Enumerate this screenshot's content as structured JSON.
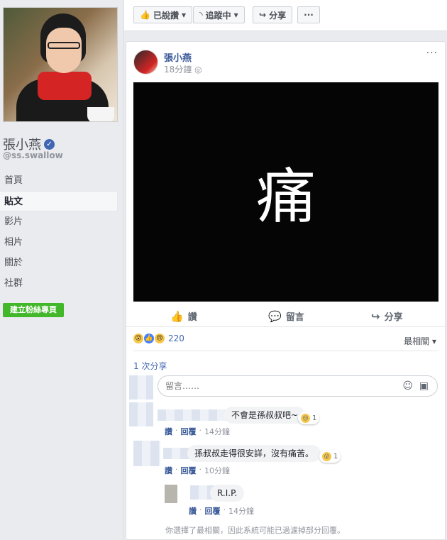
{
  "sidebar": {
    "page_name": "張小燕",
    "handle": "@ss.swallow",
    "items": [
      {
        "label": "首頁",
        "active": false
      },
      {
        "label": "貼文",
        "active": true
      },
      {
        "label": "影片",
        "active": false
      },
      {
        "label": "相片",
        "active": false
      },
      {
        "label": "關於",
        "active": false
      },
      {
        "label": "社群",
        "active": false
      }
    ],
    "create_page_label": "建立粉絲專頁"
  },
  "topbar": {
    "liked_label": "已說讚",
    "following_label": "追蹤中",
    "share_label": "分享",
    "more_label": "···"
  },
  "post": {
    "author": "張小燕",
    "time": "18分鐘",
    "image_text": "痛",
    "actions": {
      "like": "讚",
      "comment": "留言",
      "share": "分享"
    },
    "reaction_count": "220",
    "sort_label": "最相關 ▾",
    "shares_label": "1 次分享",
    "comment_placeholder": "留言……",
    "comments": [
      {
        "text": "不會是孫叔叔吧~",
        "reaction_count": "1",
        "like": "讚",
        "reply": "回覆",
        "time": "14分鐘"
      },
      {
        "text": "孫叔叔走得很安詳，沒有痛苦。",
        "reaction_count": "1",
        "like": "讚",
        "reply": "回覆",
        "time": "10分鐘"
      },
      {
        "text": "R.I.P.",
        "like": "讚",
        "reply": "回覆",
        "time": "14分鐘"
      }
    ],
    "filter_note": "你選擇了最相關，因此系統可能已過濾掉部分回覆。"
  },
  "colors": {
    "link": "#385898",
    "green": "#42b72a",
    "blue": "#4267b2"
  }
}
